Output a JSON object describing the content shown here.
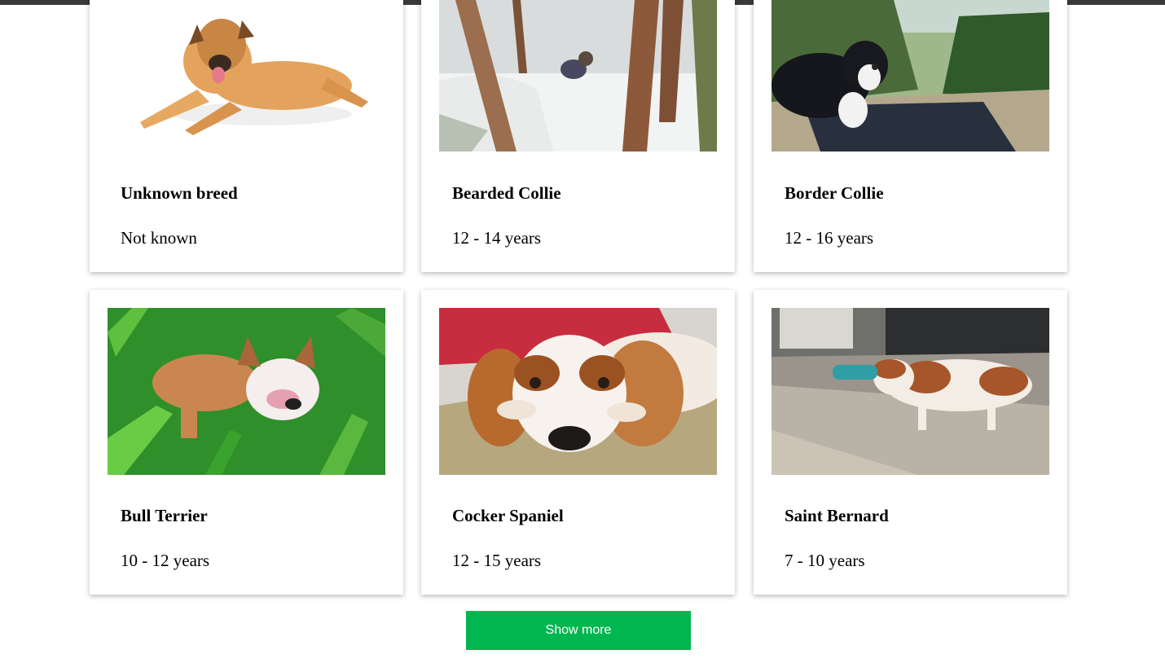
{
  "cards": [
    {
      "breed": "Unknown breed",
      "life_span": "Not known",
      "photo": "dog-lying-photo"
    },
    {
      "breed": "Bearded Collie",
      "life_span": "12 - 14 years",
      "photo": "snowy-forest-dog-photo"
    },
    {
      "breed": "Border Collie",
      "life_span": "12 - 16 years",
      "photo": "hillside-dog-photo"
    },
    {
      "breed": "Bull Terrier",
      "life_span": "10 - 12 years",
      "photo": "grass-dog-photo"
    },
    {
      "breed": "Cocker Spaniel",
      "life_span": "12 - 15 years",
      "photo": "sofa-dog-photo"
    },
    {
      "breed": "Saint Bernard",
      "life_span": "7 - 10 years",
      "photo": "street-dog-photo"
    }
  ],
  "show_more_label": "Show more",
  "colors": {
    "button": "#00b74f",
    "top_bar": "#3a3a3c"
  }
}
